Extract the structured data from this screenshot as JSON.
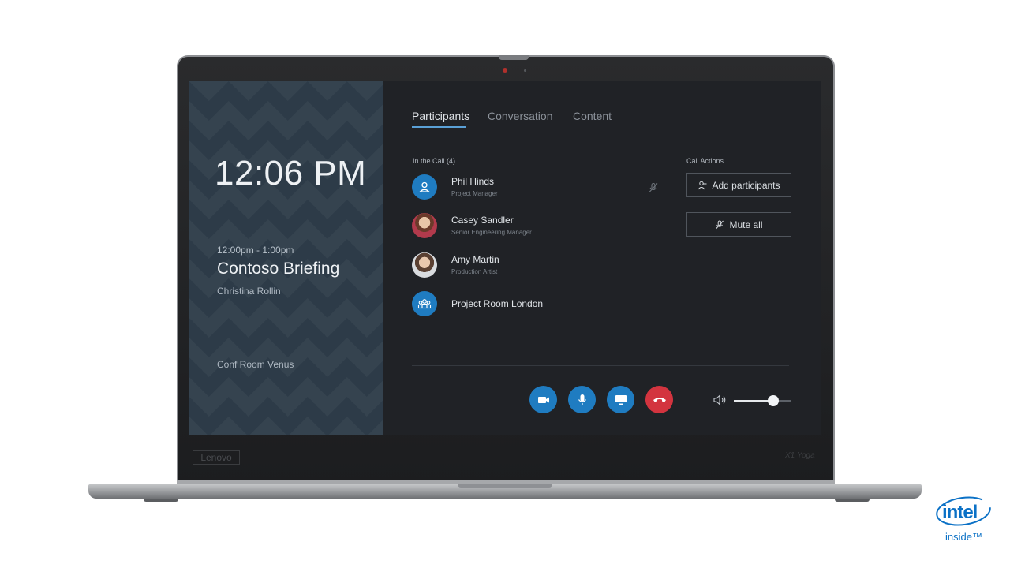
{
  "device": {
    "brand": "Lenovo",
    "model": "X1 Yoga"
  },
  "left_panel": {
    "clock": "12:06 PM",
    "meeting_time": "12:00pm - 1:00pm",
    "meeting_title": "Contoso Briefing",
    "organizer": "Christina Rollin",
    "room": "Conf Room Venus"
  },
  "tabs": [
    {
      "label": "Participants",
      "active": true
    },
    {
      "label": "Conversation",
      "active": false
    },
    {
      "label": "Content",
      "active": false
    }
  ],
  "participants_header": "In the Call (4)",
  "participants": [
    {
      "name": "Phil Hinds",
      "role": "Project Manager",
      "avatar": "person-icon"
    },
    {
      "name": "Casey Sandler",
      "role": "Senior Engineering Manager",
      "avatar": "photo"
    },
    {
      "name": "Amy Martin",
      "role": "Production Artist",
      "avatar": "photo"
    },
    {
      "name": "Project Room London",
      "role": "",
      "avatar": "group-icon"
    }
  ],
  "call_actions": {
    "header": "Call Actions",
    "add_participants": "Add participants",
    "mute_all": "Mute all"
  },
  "controls": {
    "volume_level": 0.7,
    "end_call_color": "#d3343f",
    "button_color": "#1f7cc1"
  },
  "badge": {
    "word": "intel",
    "sub": "inside™"
  }
}
